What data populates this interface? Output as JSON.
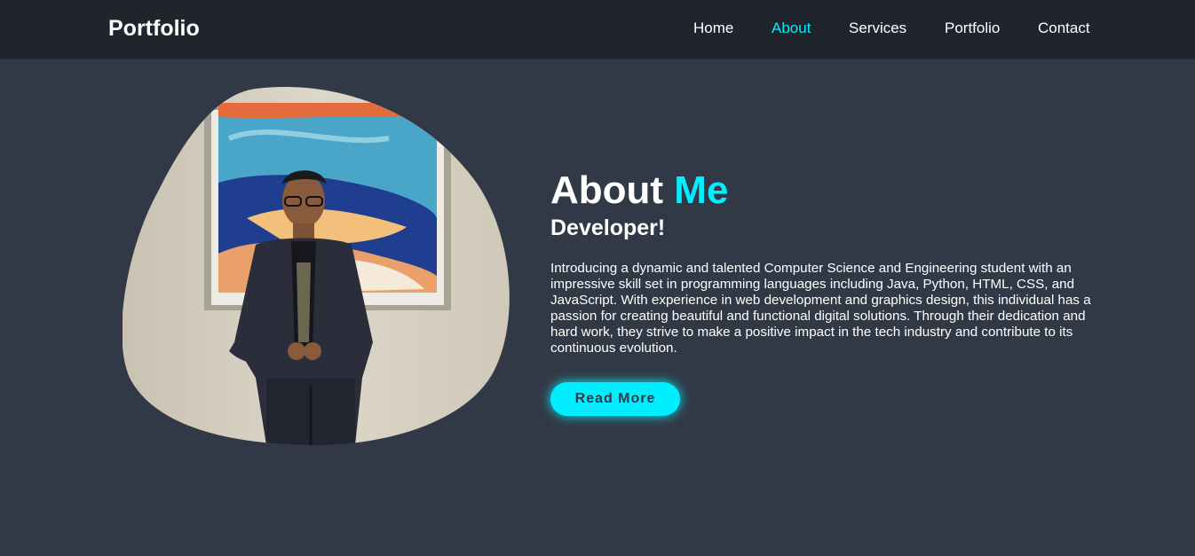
{
  "header": {
    "logo": "Portfolio",
    "nav": [
      "Home",
      "About",
      "Services",
      "Portfolio",
      "Contact"
    ],
    "active": "About"
  },
  "about": {
    "heading_main": "About",
    "heading_accent": "Me",
    "subheading": "Developer!",
    "bio": "Introducing a dynamic and talented Computer Science and Engineering student with an impressive skill set in programming languages including Java, Python, HTML, CSS, and JavaScript. With experience in web development and graphics design, this individual has a passion for creating beautiful and functional digital solutions. Through their dedication and hard work, they strive to make a positive impact in the tech industry and contribute to its continuous evolution.",
    "button": "Read More"
  },
  "colors": {
    "accent": "#00eeff",
    "background": "#323946",
    "navbar": "#1f242d"
  }
}
